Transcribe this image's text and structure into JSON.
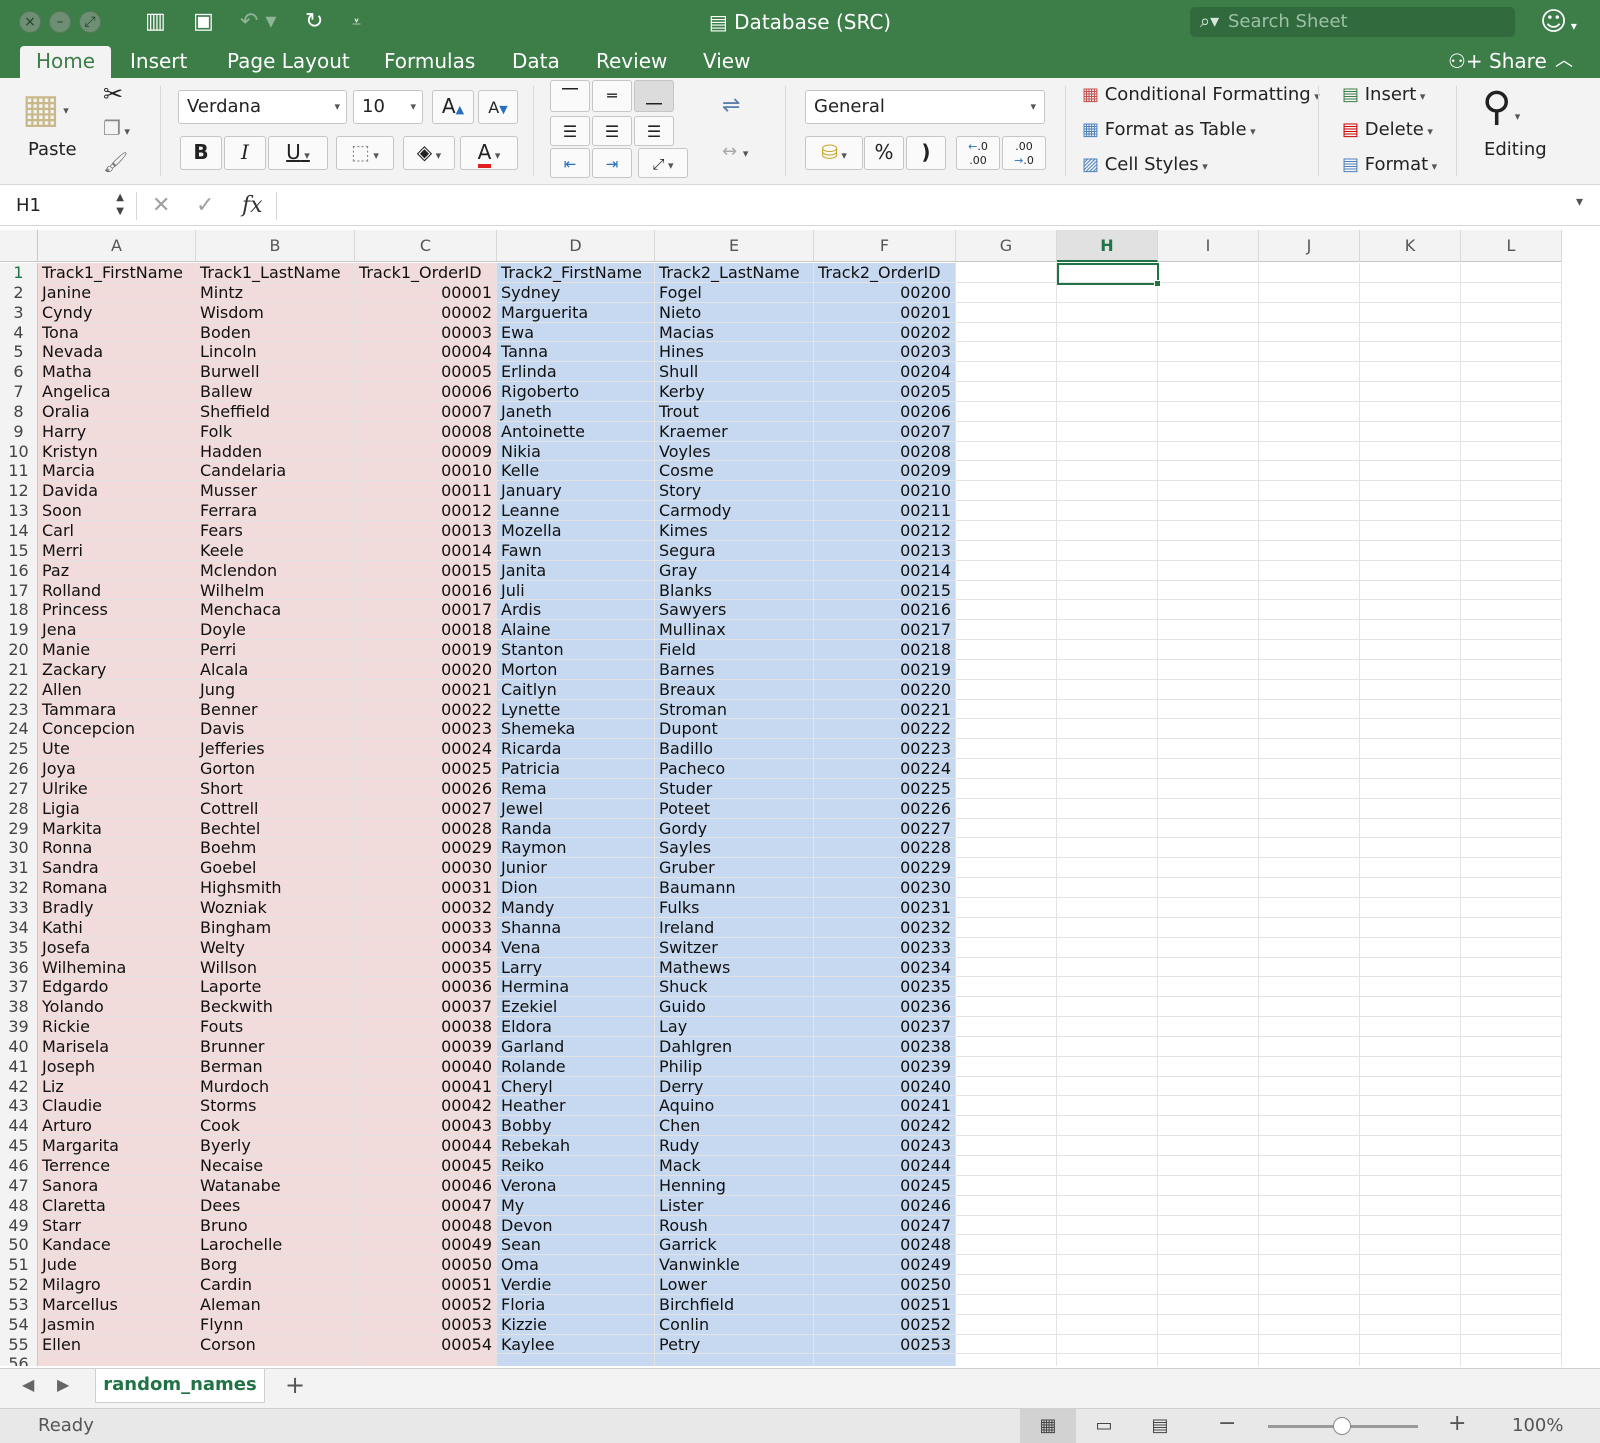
{
  "window": {
    "title": "Database (SRC)",
    "search_placeholder": "Search Sheet"
  },
  "tabs": [
    "Home",
    "Insert",
    "Page Layout",
    "Formulas",
    "Data",
    "Review",
    "View"
  ],
  "share_label": "Share",
  "ribbon": {
    "paste": "Paste",
    "font_name": "Verdana",
    "font_size": "10",
    "bold": "B",
    "italic": "I",
    "underline": "U",
    "number_format": "General",
    "percent": "%",
    "comma": ")",
    "inc_decimal": ".00",
    "dec_decimal": ".0",
    "conditional_formatting": "Conditional Formatting",
    "format_as_table": "Format as Table",
    "cell_styles": "Cell Styles",
    "insert": "Insert",
    "delete": "Delete",
    "format": "Format",
    "editing": "Editing"
  },
  "formula_bar": {
    "name_box": "H1",
    "fx": "fx",
    "formula": ""
  },
  "columns": [
    "A",
    "B",
    "C",
    "D",
    "E",
    "F",
    "G",
    "H",
    "I",
    "J",
    "K",
    "L"
  ],
  "selected_column": "H",
  "headers": [
    "Track1_FirstName",
    "Track1_LastName",
    "Track1_OrderID",
    "Track2_FirstName",
    "Track2_LastName",
    "Track2_OrderID"
  ],
  "rows": [
    [
      "Janine",
      "Mintz",
      "00001",
      "Sydney",
      "Fogel",
      "00200"
    ],
    [
      "Cyndy",
      "Wisdom",
      "00002",
      "Marguerita",
      "Nieto",
      "00201"
    ],
    [
      "Tona",
      "Boden",
      "00003",
      "Ewa",
      "Macias",
      "00202"
    ],
    [
      "Nevada",
      "Lincoln",
      "00004",
      "Tanna",
      "Hines",
      "00203"
    ],
    [
      "Matha",
      "Burwell",
      "00005",
      "Erlinda",
      "Shull",
      "00204"
    ],
    [
      "Angelica",
      "Ballew",
      "00006",
      "Rigoberto",
      "Kerby",
      "00205"
    ],
    [
      "Oralia",
      "Sheffield",
      "00007",
      "Janeth",
      "Trout",
      "00206"
    ],
    [
      "Harry",
      "Folk",
      "00008",
      "Antoinette",
      "Kraemer",
      "00207"
    ],
    [
      "Kristyn",
      "Hadden",
      "00009",
      "Nikia",
      "Voyles",
      "00208"
    ],
    [
      "Marcia",
      "Candelaria",
      "00010",
      "Kelle",
      "Cosme",
      "00209"
    ],
    [
      "Davida",
      "Musser",
      "00011",
      "January",
      "Story",
      "00210"
    ],
    [
      "Soon",
      "Ferrara",
      "00012",
      "Leanne",
      "Carmody",
      "00211"
    ],
    [
      "Carl",
      "Fears",
      "00013",
      "Mozella",
      "Kimes",
      "00212"
    ],
    [
      "Merri",
      "Keele",
      "00014",
      "Fawn",
      "Segura",
      "00213"
    ],
    [
      "Paz",
      "Mclendon",
      "00015",
      "Janita",
      "Gray",
      "00214"
    ],
    [
      "Rolland",
      "Wilhelm",
      "00016",
      "Juli",
      "Blanks",
      "00215"
    ],
    [
      "Princess",
      "Menchaca",
      "00017",
      "Ardis",
      "Sawyers",
      "00216"
    ],
    [
      "Jena",
      "Doyle",
      "00018",
      "Alaine",
      "Mullinax",
      "00217"
    ],
    [
      "Manie",
      "Perri",
      "00019",
      "Stanton",
      "Field",
      "00218"
    ],
    [
      "Zackary",
      "Alcala",
      "00020",
      "Morton",
      "Barnes",
      "00219"
    ],
    [
      "Allen",
      "Jung",
      "00021",
      "Caitlyn",
      "Breaux",
      "00220"
    ],
    [
      "Tammara",
      "Benner",
      "00022",
      "Lynette",
      "Stroman",
      "00221"
    ],
    [
      "Concepcion",
      "Davis",
      "00023",
      "Shemeka",
      "Dupont",
      "00222"
    ],
    [
      "Ute",
      "Jefferies",
      "00024",
      "Ricarda",
      "Badillo",
      "00223"
    ],
    [
      "Joya",
      "Gorton",
      "00025",
      "Patricia",
      "Pacheco",
      "00224"
    ],
    [
      "Ulrike",
      "Short",
      "00026",
      "Rema",
      "Studer",
      "00225"
    ],
    [
      "Ligia",
      "Cottrell",
      "00027",
      "Jewel",
      "Poteet",
      "00226"
    ],
    [
      "Markita",
      "Bechtel",
      "00028",
      "Randa",
      "Gordy",
      "00227"
    ],
    [
      "Ronna",
      "Boehm",
      "00029",
      "Raymon",
      "Sayles",
      "00228"
    ],
    [
      "Sandra",
      "Goebel",
      "00030",
      "Junior",
      "Gruber",
      "00229"
    ],
    [
      "Romana",
      "Highsmith",
      "00031",
      "Dion",
      "Baumann",
      "00230"
    ],
    [
      "Bradly",
      "Wozniak",
      "00032",
      "Mandy",
      "Fulks",
      "00231"
    ],
    [
      "Kathi",
      "Bingham",
      "00033",
      "Shanna",
      "Ireland",
      "00232"
    ],
    [
      "Josefa",
      "Welty",
      "00034",
      "Vena",
      "Switzer",
      "00233"
    ],
    [
      "Wilhemina",
      "Willson",
      "00035",
      "Larry",
      "Mathews",
      "00234"
    ],
    [
      "Edgardo",
      "Laporte",
      "00036",
      "Hermina",
      "Shuck",
      "00235"
    ],
    [
      "Yolando",
      "Beckwith",
      "00037",
      "Ezekiel",
      "Guido",
      "00236"
    ],
    [
      "Rickie",
      "Fouts",
      "00038",
      "Eldora",
      "Lay",
      "00237"
    ],
    [
      "Marisela",
      "Brunner",
      "00039",
      "Garland",
      "Dahlgren",
      "00238"
    ],
    [
      "Joseph",
      "Berman",
      "00040",
      "Rolande",
      "Philip",
      "00239"
    ],
    [
      "Liz",
      "Murdoch",
      "00041",
      "Cheryl",
      "Derry",
      "00240"
    ],
    [
      "Claudie",
      "Storms",
      "00042",
      "Heather",
      "Aquino",
      "00241"
    ],
    [
      "Arturo",
      "Cook",
      "00043",
      "Bobby",
      "Chen",
      "00242"
    ],
    [
      "Margarita",
      "Byerly",
      "00044",
      "Rebekah",
      "Rudy",
      "00243"
    ],
    [
      "Terrence",
      "Necaise",
      "00045",
      "Reiko",
      "Mack",
      "00244"
    ],
    [
      "Sanora",
      "Watanabe",
      "00046",
      "Verona",
      "Henning",
      "00245"
    ],
    [
      "Claretta",
      "Dees",
      "00047",
      "My",
      "Lister",
      "00246"
    ],
    [
      "Starr",
      "Bruno",
      "00048",
      "Devon",
      "Roush",
      "00247"
    ],
    [
      "Kandace",
      "Larochelle",
      "00049",
      "Sean",
      "Garrick",
      "00248"
    ],
    [
      "Jude",
      "Borg",
      "00050",
      "Oma",
      "Vanwinkle",
      "00249"
    ],
    [
      "Milagro",
      "Cardin",
      "00051",
      "Verdie",
      "Lower",
      "00250"
    ],
    [
      "Marcellus",
      "Aleman",
      "00052",
      "Floria",
      "Birchfield",
      "00251"
    ],
    [
      "Jasmin",
      "Flynn",
      "00053",
      "Kizzie",
      "Conlin",
      "00252"
    ],
    [
      "Ellen",
      "Corson",
      "00054",
      "Kaylee",
      "Petry",
      "00253"
    ]
  ],
  "sheet_tab": "random_names",
  "status": {
    "text": "Ready",
    "zoom": "100%"
  }
}
